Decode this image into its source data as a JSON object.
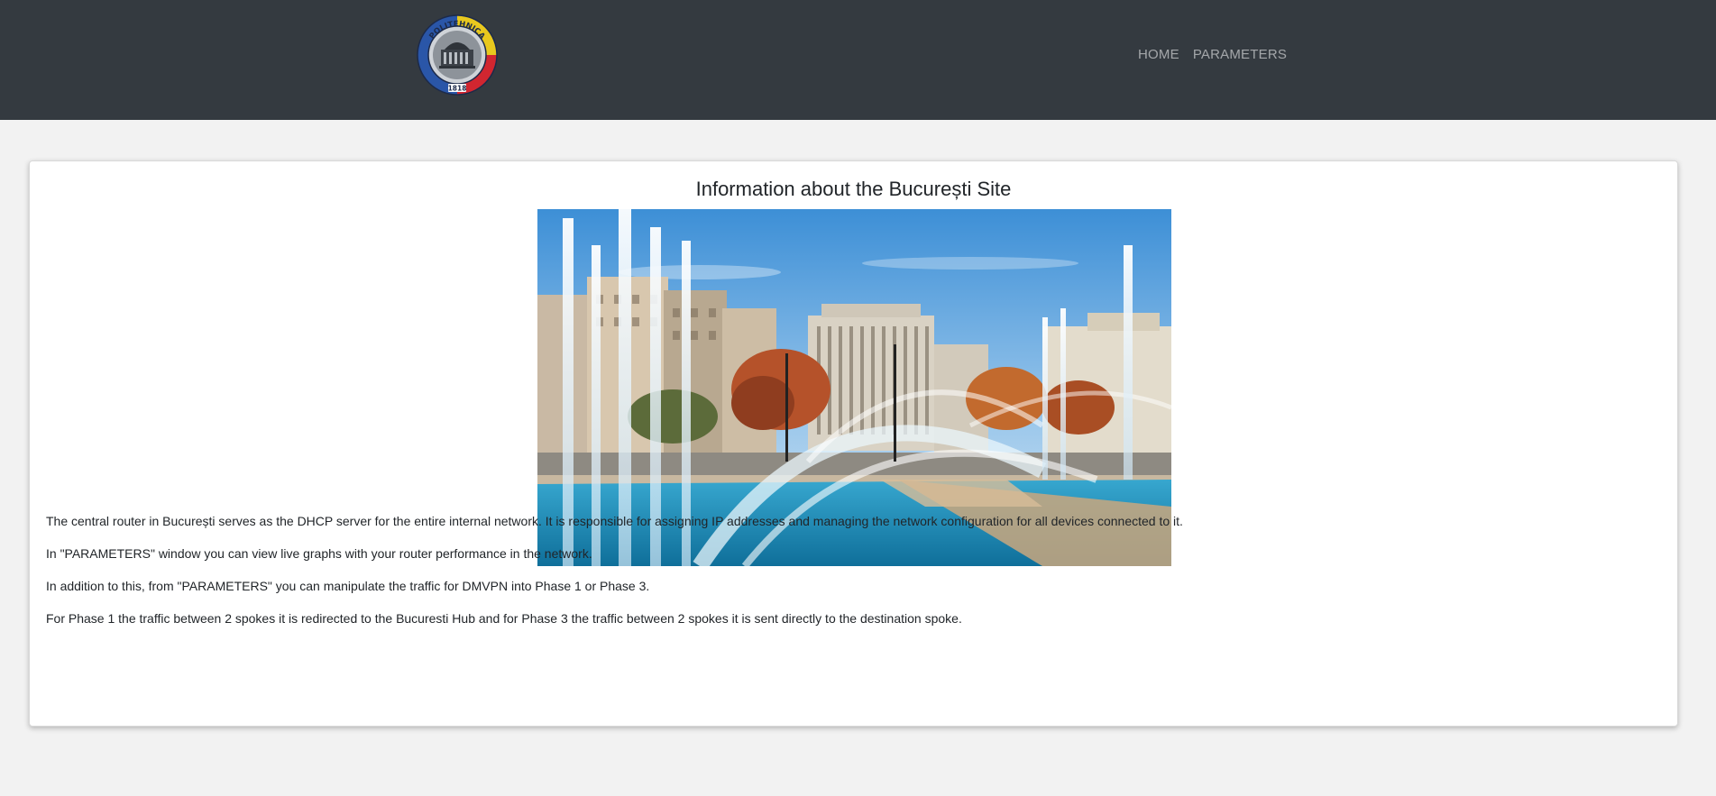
{
  "navbar": {
    "logo": {
      "top_text": "POLITEHNICA",
      "year": "1818",
      "alt": "university-logo"
    },
    "links": [
      {
        "label": "HOME"
      },
      {
        "label": "PARAMETERS"
      }
    ]
  },
  "main": {
    "title": "Information about the București Site",
    "paragraphs": [
      "The central router in București serves as the DHCP server for the entire internal network. It is responsible for assigning IP addresses and managing the network configuration for all devices connected to it.",
      "In \"PARAMETERS\" window you can view live graphs with your router performance in the network.",
      "In addition to this, from \"PARAMETERS\" you can manipulate the traffic for DMVPN into Phase 1 or Phase 3.",
      "For Phase 1 the traffic between 2 spokes it is redirected to the Bucuresti Hub and for Phase 3 the traffic between 2 spokes it is sent directly to the destination spoke."
    ]
  },
  "colors": {
    "navbar_bg": "#343a40",
    "page_bg": "#f2f2f2",
    "card_bg": "#ffffff",
    "nav_link": "rgba(255,255,255,0.55)"
  }
}
